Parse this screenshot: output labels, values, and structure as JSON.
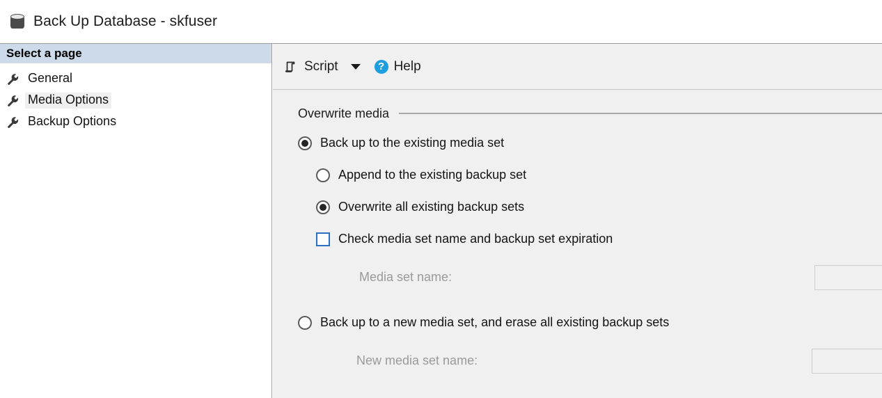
{
  "window": {
    "title": "Back Up Database - skfuser",
    "title_icon": "database-icon"
  },
  "sidebar": {
    "header": "Select a page",
    "items": [
      {
        "label": "General",
        "icon": "wrench-icon",
        "selected": false
      },
      {
        "label": "Media Options",
        "icon": "wrench-icon",
        "selected": true
      },
      {
        "label": "Backup Options",
        "icon": "wrench-icon",
        "selected": false
      }
    ]
  },
  "toolbar": {
    "script_label": "Script",
    "script_icon": "script-icon",
    "dropdown_icon": "chevron-down-icon",
    "help_label": "Help",
    "help_icon": "help-circle-icon"
  },
  "main": {
    "group_title": "Overwrite media",
    "options": [
      {
        "id": "existing-media-set",
        "type": "radio",
        "label": "Back up to the existing media set",
        "checked": true,
        "indent": 0
      },
      {
        "id": "append-existing-backup-set",
        "type": "radio",
        "label": "Append to the existing backup set",
        "checked": false,
        "indent": 1
      },
      {
        "id": "overwrite-all-backup-sets",
        "type": "radio",
        "label": "Overwrite all existing backup sets",
        "checked": true,
        "indent": 1
      },
      {
        "id": "check-media-set-name",
        "type": "checkbox",
        "label": "Check media set name and backup set expiration",
        "checked": false,
        "indent": 1
      }
    ],
    "media_set_name": {
      "label": "Media set name:",
      "value": "",
      "disabled": true
    },
    "new_media_set_option": {
      "id": "new-media-set",
      "type": "radio",
      "label": "Back up to a new media set, and erase all existing backup sets",
      "checked": false
    },
    "new_media_set_name": {
      "label": "New media set name:",
      "value": "",
      "disabled": true
    }
  },
  "colors": {
    "panel_bg": "#f0f0f0",
    "sidebar_header_bg": "#ccdaea",
    "accent_blue": "#2b6fc4",
    "help_blue": "#1d9ede",
    "disabled_text": "#9a9a9a"
  }
}
